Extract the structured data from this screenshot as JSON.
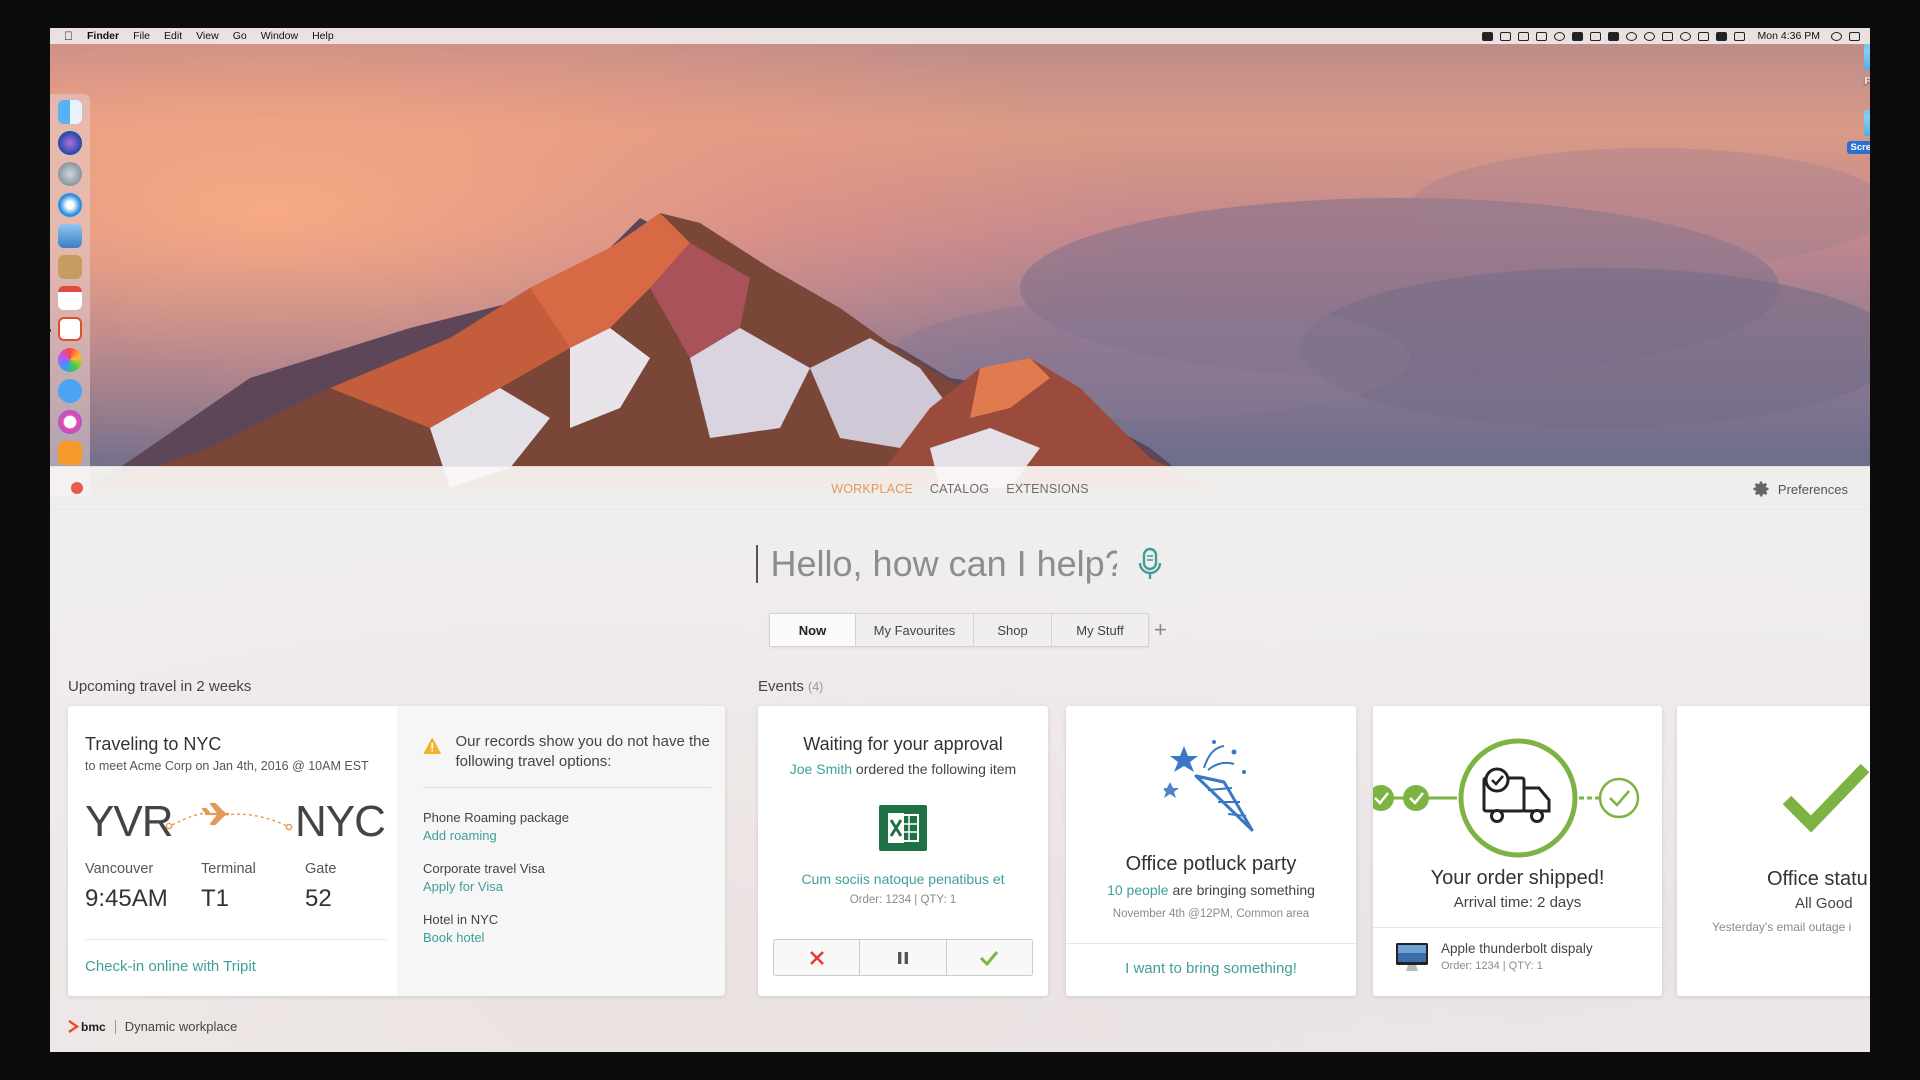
{
  "menubar": {
    "app_name": "Finder",
    "items": [
      "File",
      "Edit",
      "View",
      "Go",
      "Window",
      "Help"
    ],
    "clock": "Mon 4:36 PM"
  },
  "desktop": {
    "icons": [
      {
        "label": "Folder",
        "selected": false
      },
      {
        "label": "Screenshots",
        "selected": true
      }
    ]
  },
  "app": {
    "nav": {
      "items": [
        "WORKPLACE",
        "CATALOG",
        "EXTENSIONS"
      ],
      "active": "WORKPLACE"
    },
    "preferences_label": "Preferences",
    "search_placeholder": "Hello, how can I help?",
    "tabs": [
      "Now",
      "My Favourites",
      "Shop",
      "My Stuff"
    ],
    "active_tab": "Now",
    "add_tab_symbol": "+",
    "travel": {
      "section_title": "Upcoming travel in 2 weeks",
      "title": "Traveling to NYC",
      "subtitle": "to meet Acme Corp on Jan 4th, 2016 @ 10AM EST",
      "from_code": "YVR",
      "to_code": "NYC",
      "city_label": "Vancouver",
      "departure_time": "9:45AM",
      "terminal_label": "Terminal",
      "terminal": "T1",
      "gate_label": "Gate",
      "gate": "52",
      "checkin_link": "Check-in online with Tripit",
      "warning": "Our records show you do not have the following travel options:",
      "options": [
        {
          "title": "Phone Roaming package",
          "link": "Add roaming"
        },
        {
          "title": "Corporate travel Visa",
          "link": "Apply for Visa"
        },
        {
          "title": "Hotel in NYC",
          "link": "Book hotel"
        }
      ]
    },
    "events": {
      "section_title": "Events",
      "count": "(4)",
      "approval": {
        "title": "Waiting for your approval",
        "person": "Joe Smith",
        "subtitle_rest": "ordered the following item",
        "item_link": "Cum sociis natoque penatibus et",
        "meta": "Order: 1234  |  QTY: 1"
      },
      "potluck": {
        "title": "Office potluck party",
        "people_link": "10 people",
        "subtitle_rest": "are bringing something",
        "meta": "November 4th @12PM, Common area",
        "action_link": "I want to bring something!"
      },
      "shipped": {
        "title": "Your order shipped!",
        "subtitle": "Arrival time: 2 days",
        "product": "Apple thunderbolt dispaly",
        "meta": "Order: 1234  |  QTY: 1"
      },
      "status": {
        "title": "Office statu",
        "subtitle": "All Good",
        "meta": "Yesterday's email outage i"
      }
    },
    "footer": {
      "brand": "bmc",
      "label": "Dynamic workplace"
    }
  },
  "colors": {
    "accent_orange": "#e39a57",
    "teal_link": "#3f9e9b",
    "green": "#7cb342",
    "reject_red": "#e53935",
    "close_red": "#e85a4f",
    "excel_green": "#1e7145",
    "party_blue": "#3b78c3"
  },
  "icons": [
    "apple-logo-icon",
    "gear-icon",
    "microphone-icon",
    "plane-icon",
    "warning-icon",
    "excel-icon",
    "reject-x-icon",
    "pause-icon",
    "approve-check-icon",
    "party-popper-icon",
    "delivery-truck-icon",
    "monitor-icon",
    "big-check-icon"
  ]
}
